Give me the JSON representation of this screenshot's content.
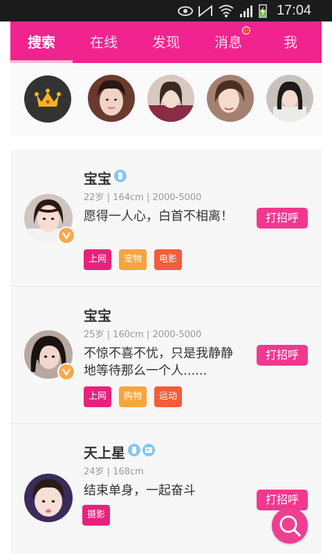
{
  "status_bar": {
    "time": "17:04"
  },
  "tabs": [
    {
      "label": "搜索",
      "active": true
    },
    {
      "label": "在线",
      "active": false
    },
    {
      "label": "发现",
      "active": false
    },
    {
      "label": "消息",
      "active": false,
      "has_dot": true
    },
    {
      "label": "我",
      "active": false
    }
  ],
  "colors": {
    "accent": "#f0238f",
    "tag_pink": "#e8217d",
    "tag_orange": "#f8a43e",
    "tag_red": "#f45c3a",
    "greet_button": "#f2378f"
  },
  "users": [
    {
      "name": "宝宝",
      "meta": "22岁 | 164cm | 2000-5000",
      "signature": "愿得一人心，白首不相离！",
      "tags": [
        "上网",
        "宠物",
        "电影"
      ],
      "greet_label": "打招呼"
    },
    {
      "name": "宝宝",
      "meta": "25岁 | 160cm | 2000-5000",
      "signature": "不惊不喜不忧，只是我静静地等待那么一个人......",
      "tags": [
        "上网",
        "购物",
        "运动"
      ],
      "greet_label": "打招呼"
    },
    {
      "name": "天上星",
      "meta": "24岁 | 168cm",
      "signature": "结束单身，一起奋斗",
      "tags": [
        "摄影"
      ],
      "greet_label": "打招呼"
    }
  ]
}
